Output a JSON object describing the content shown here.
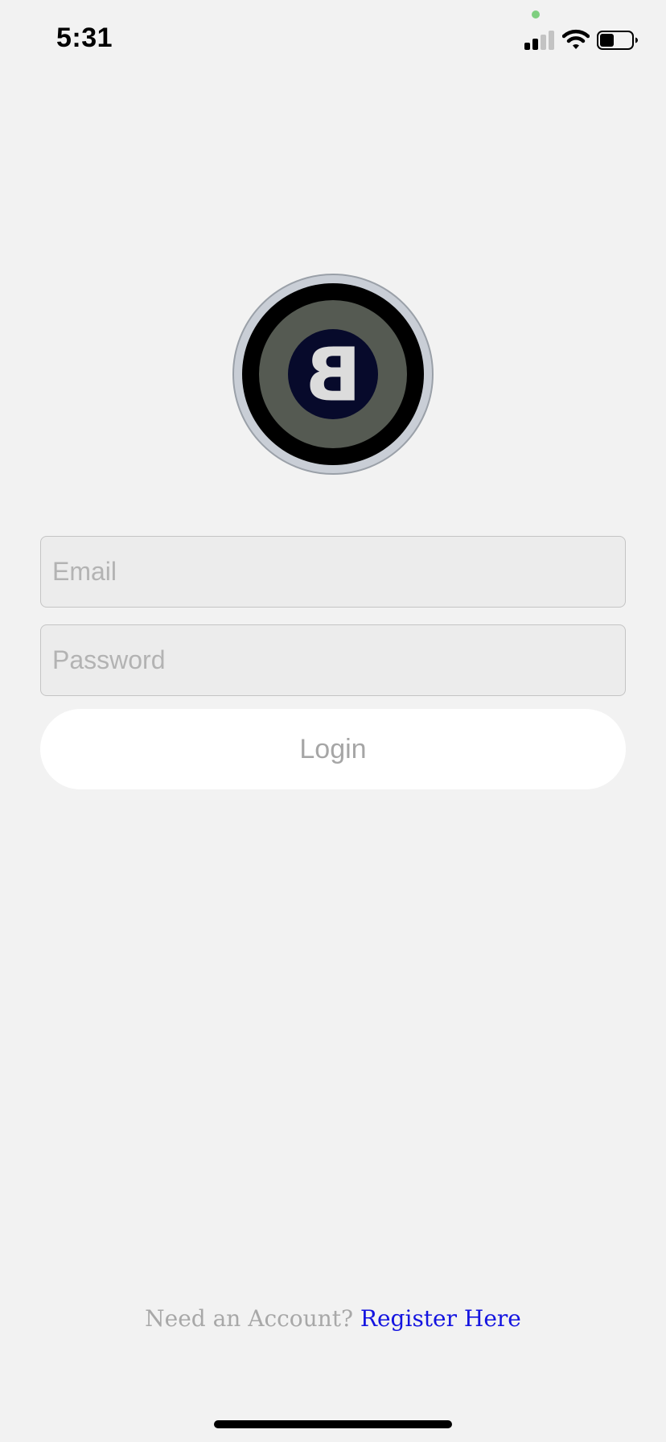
{
  "status_bar": {
    "time": "5:31",
    "privacy_indicator_color": "#7fcf80",
    "signal_icon": "cellular-signal-icon",
    "wifi_icon": "wifi-icon",
    "battery_icon": "battery-icon",
    "battery_level": 0.45
  },
  "logo": {
    "icon": "brand-logo-icon",
    "letter": "B",
    "colors": {
      "outer_ring": "#c9ced6",
      "black_ring": "#000000",
      "mid_disc": "#555a52",
      "inner_disc": "#070a2b",
      "letter": "#dcdcdc"
    }
  },
  "form": {
    "email_placeholder": "Email",
    "email_value": "",
    "password_placeholder": "Password",
    "password_value": "",
    "login_label": "Login"
  },
  "footer": {
    "register_prompt": "Need an Account?",
    "register_link": "Register Here",
    "link_color": "#1414e0"
  }
}
